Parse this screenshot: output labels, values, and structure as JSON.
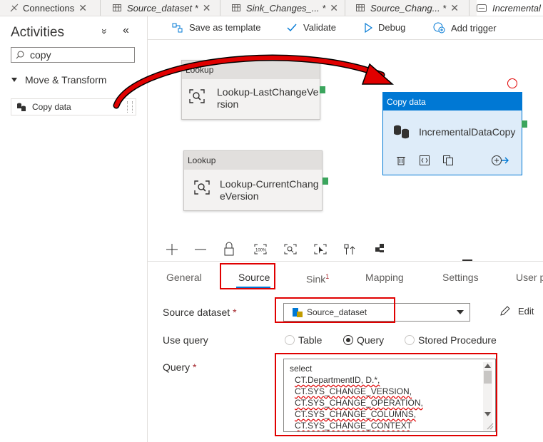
{
  "tabs": [
    {
      "label": "Connections",
      "close": "✕"
    },
    {
      "label": "Source_dataset *",
      "close": "✕"
    },
    {
      "label": "Sink_Changes_... *",
      "close": "✕"
    },
    {
      "label": "Source_Chang... *",
      "close": "✕"
    },
    {
      "label": "Incremental",
      "close": ""
    }
  ],
  "sidebar": {
    "title": "Activities",
    "collapse_glyph": "«",
    "expand_glyph": "»",
    "search_value": "copy",
    "category": "Move & Transform",
    "items": [
      {
        "label": "Copy data"
      }
    ]
  },
  "toolbar": {
    "save_template": "Save as template",
    "validate": "Validate",
    "debug": "Debug",
    "add_trigger": "Add trigger"
  },
  "canvas": {
    "nodes": [
      {
        "type": "Lookup",
        "name_line1": "Lookup-LastChangeVe",
        "name_line2": "rsion"
      },
      {
        "type": "Lookup",
        "name_line1": "Lookup-CurrentChang",
        "name_line2": "eVersion"
      }
    ],
    "copy_node": {
      "type": "Copy data",
      "name": "IncrementalDataCopy"
    },
    "zoom_label": "100%"
  },
  "panel": {
    "tabs": [
      {
        "label": "General"
      },
      {
        "label": "Source"
      },
      {
        "label": "Sink",
        "badge": "1"
      },
      {
        "label": "Mapping"
      },
      {
        "label": "Settings"
      },
      {
        "label": "User p"
      }
    ],
    "source_dataset_label": "Source dataset",
    "required_mark": "*",
    "source_dataset_value": "Source_dataset",
    "edit_label": "Edit",
    "use_query_label": "Use query",
    "use_query_options": [
      "Table",
      "Query",
      "Stored Procedure"
    ],
    "use_query_selected": "Query",
    "query_label": "Query",
    "query_lines": [
      "select",
      "CT.DepartmentID, D.*,",
      "CT.SYS_CHANGE_VERSION,",
      "CT.SYS_CHANGE_OPERATION,",
      "CT.SYS_CHANGE_COLUMNS,",
      "CT.SYS_CHANGE_CONTEXT"
    ]
  },
  "colors": {
    "accent": "#0078d4",
    "annotation_red": "#e00000",
    "port_green": "#3ba55d"
  }
}
